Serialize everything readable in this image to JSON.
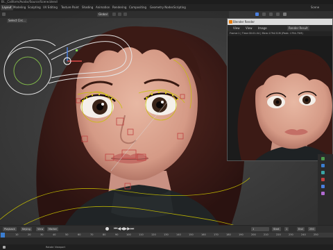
{
  "window": {
    "title": "Bl.._Caliform/Avatar/Source/Scene.blend"
  },
  "workspaces": [
    "Layout",
    "Modeling",
    "Sculpting",
    "UV Editing",
    "Texture Paint",
    "Shading",
    "Animation",
    "Rendering",
    "Compositing",
    "Geometry Nodes",
    "Scripting"
  ],
  "scene_label": "Scene",
  "viewport": {
    "mode_label": "Global",
    "select_label": "Select Circ...",
    "view_label": "View"
  },
  "render_window": {
    "title": "Blender Render",
    "menu": [
      "View",
      "View",
      "Image"
    ],
    "slot_label": "Render Result",
    "info": "Frame:1 | Time:00:01.04 | Mem:1794.51M (Peak: 1794.75M)"
  },
  "timeline": {
    "playback": "Playback",
    "keying": "Keying",
    "view": "View",
    "marker": "Marker",
    "current_frame": "1",
    "start_label": "Start",
    "start_value": "1",
    "end_label": "End",
    "end_value": "250",
    "ticks": [
      "0",
      "10",
      "20",
      "30",
      "40",
      "50",
      "60",
      "70",
      "80",
      "90",
      "100",
      "110",
      "120",
      "130",
      "140",
      "150",
      "160",
      "170",
      "180",
      "190",
      "200",
      "210",
      "220",
      "230",
      "240",
      "250"
    ]
  },
  "status": {
    "text": "Rotate Viewport"
  },
  "colors": {
    "accent": "#e87d0d",
    "bone_yellow": "#d8d200",
    "select_white": "#ffffff",
    "ctrl_red": "#cc3333"
  },
  "icons": [
    "cursor-icon",
    "move-icon",
    "rotate-icon",
    "scale-icon",
    "camera-icon",
    "light-icon",
    "render-icon",
    "close-icon"
  ]
}
